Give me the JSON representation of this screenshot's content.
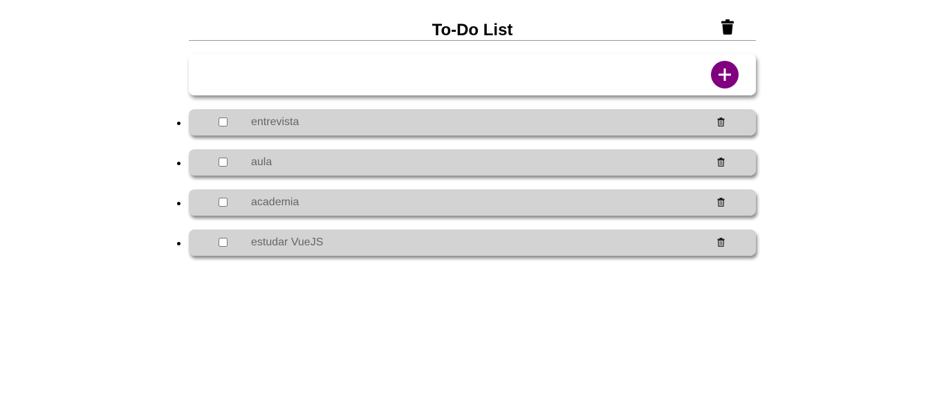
{
  "header": {
    "title": "To-Do List",
    "clear_icon": "trash-icon"
  },
  "add_form": {
    "input_value": "",
    "placeholder": "",
    "add_icon": "plus-icon",
    "accent_color": "#800080"
  },
  "tasks": [
    {
      "text": "entrevista",
      "done": false,
      "delete_icon": "trash-icon"
    },
    {
      "text": "aula",
      "done": false,
      "delete_icon": "trash-icon"
    },
    {
      "text": "academia",
      "done": false,
      "delete_icon": "trash-icon"
    },
    {
      "text": "estudar VueJS",
      "done": false,
      "delete_icon": "trash-icon"
    }
  ],
  "colors": {
    "task_background": "#d3d3d3",
    "task_text": "#666666"
  }
}
